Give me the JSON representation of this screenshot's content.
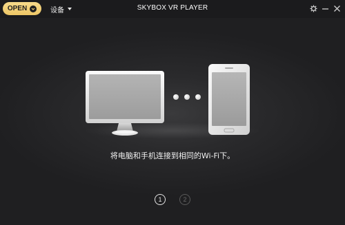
{
  "header": {
    "open_label": "OPEN",
    "device_menu_label": "设备",
    "title": "SKYBOX VR PLAYER"
  },
  "icons": {
    "open": "chevron-down-icon",
    "settings": "gear-icon",
    "minimize": "minimize-icon",
    "close": "close-icon"
  },
  "main": {
    "instruction": "将电脑和手机连接到相同的Wi-Fi下。"
  },
  "pager": {
    "pages": [
      "1",
      "2"
    ],
    "current": "1"
  },
  "colors": {
    "accent": "#f2cf74",
    "background": "#202022"
  }
}
